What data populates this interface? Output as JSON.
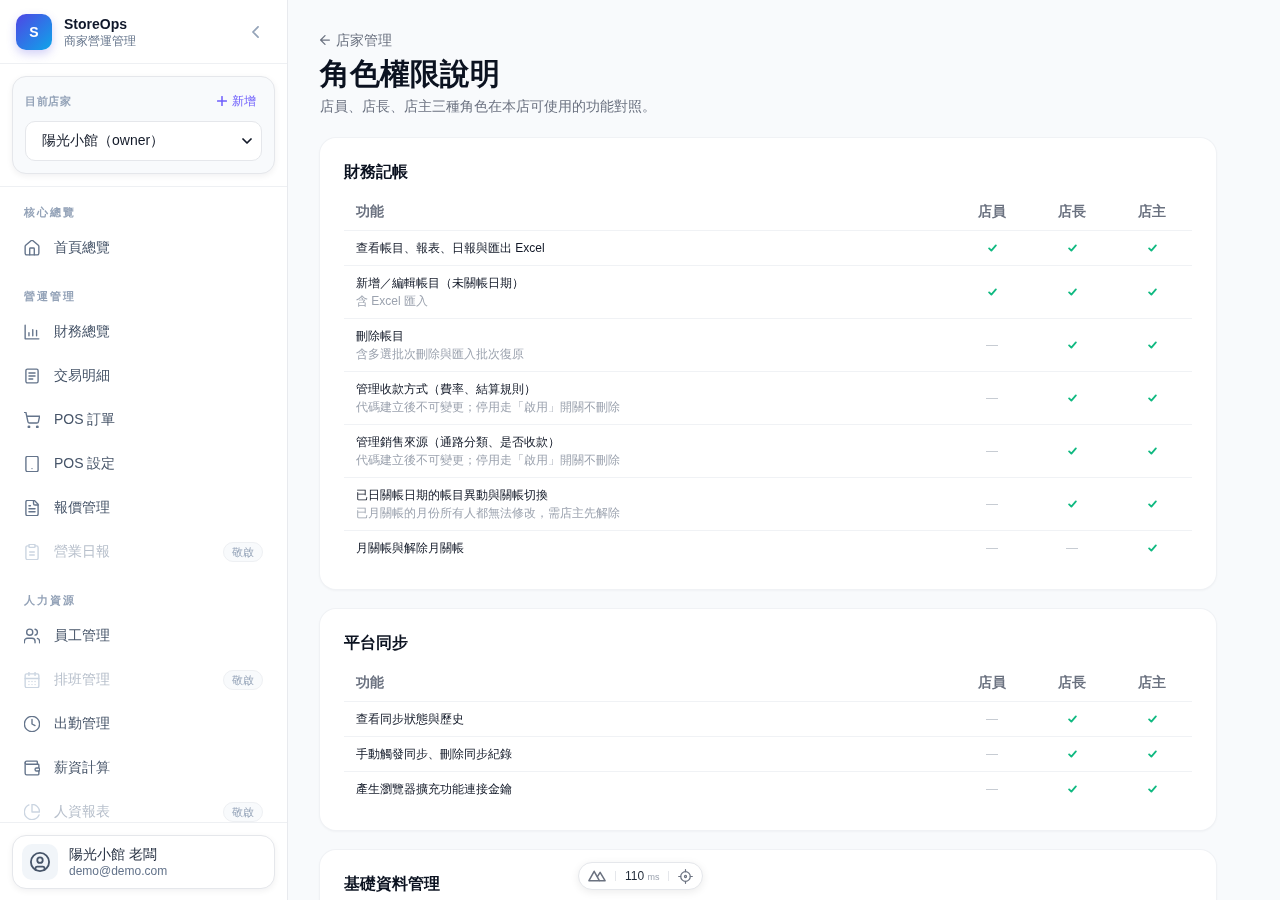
{
  "sidebar": {
    "brand": {
      "logo_letter": "S",
      "name": "StoreOps",
      "tagline": "商家營運管理"
    },
    "store_switcher": {
      "label": "目前店家",
      "add_label": "新增",
      "value": "陽光小館（owner）"
    },
    "nav_sections": [
      {
        "title": "核心總覽",
        "items": [
          {
            "label": "首頁總覽",
            "selected": false,
            "disabled": false
          }
        ]
      },
      {
        "title": "營運管理",
        "items": [
          {
            "label": "財務總覽",
            "selected": false,
            "disabled": false
          },
          {
            "label": "交易明細",
            "selected": false,
            "disabled": false
          },
          {
            "label": "POS 訂單",
            "selected": false,
            "disabled": false
          },
          {
            "label": "POS 設定",
            "selected": false,
            "disabled": false
          },
          {
            "label": "報價管理",
            "selected": false,
            "disabled": false
          },
          {
            "label": "營業日報",
            "selected": false,
            "disabled": true,
            "badge": "敬啟"
          }
        ]
      },
      {
        "title": "人力資源",
        "items": [
          {
            "label": "員工管理",
            "selected": false,
            "disabled": false
          },
          {
            "label": "排班管理",
            "selected": false,
            "disabled": true,
            "badge": "敬啟"
          },
          {
            "label": "出勤管理",
            "selected": false,
            "disabled": false
          },
          {
            "label": "薪資計算",
            "selected": false,
            "disabled": false
          },
          {
            "label": "人資報表",
            "selected": false,
            "disabled": true,
            "badge": "敬啟"
          }
        ]
      }
    ],
    "user": {
      "name": "陽光小館 老闆",
      "email": "demo@demo.com"
    }
  },
  "page": {
    "back_link": "店家管理",
    "title": "角色權限說明",
    "subtitle": "店員、店長、店主三種角色在本店可使用的功能對照。"
  },
  "sections": [
    {
      "title": "財務記帳",
      "columns": [
        "功能",
        "店員",
        "店長",
        "店主"
      ],
      "rows": [
        {
          "feature": "查看帳目、報表、日報與匯出 Excel",
          "access": [
            true,
            true,
            true
          ]
        },
        {
          "feature": "新增／編輯帳目（未關帳日期）",
          "note": "含 Excel 匯入",
          "access": [
            true,
            true,
            true
          ]
        },
        {
          "feature": "刪除帳目",
          "note": "含多選批次刪除與匯入批次復原",
          "access": [
            false,
            true,
            true
          ]
        },
        {
          "feature": "管理收款方式（費率、結算規則）",
          "note": "代碼建立後不可變更；停用走「啟用」開關不刪除",
          "access": [
            false,
            true,
            true
          ]
        },
        {
          "feature": "管理銷售來源（通路分類、是否收款）",
          "note": "代碼建立後不可變更；停用走「啟用」開關不刪除",
          "access": [
            false,
            true,
            true
          ]
        },
        {
          "feature": "已日關帳日期的帳目異動與關帳切換",
          "note": "已月關帳的月份所有人都無法修改，需店主先解除",
          "access": [
            false,
            true,
            true
          ]
        },
        {
          "feature": "月關帳與解除月關帳",
          "access": [
            false,
            false,
            true
          ]
        }
      ]
    },
    {
      "title": "平台同步",
      "columns": [
        "功能",
        "店員",
        "店長",
        "店主"
      ],
      "rows": [
        {
          "feature": "查看同步狀態與歷史",
          "access": [
            false,
            true,
            true
          ]
        },
        {
          "feature": "手動觸發同步、刪除同步紀錄",
          "access": [
            false,
            true,
            true
          ]
        },
        {
          "feature": "產生瀏覽器擴充功能連接金鑰",
          "access": [
            false,
            true,
            true
          ]
        }
      ]
    },
    {
      "title": "基礎資料管理"
    }
  ],
  "devtools_bar": {
    "timing": "110",
    "unit": "ms"
  }
}
